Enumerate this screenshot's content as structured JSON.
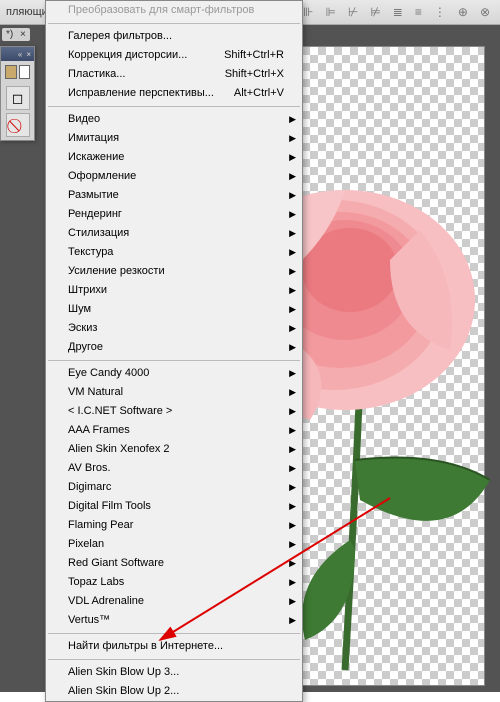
{
  "toolbar": {
    "label_fragment": "пляющие элементы",
    "file_tab": "*)"
  },
  "menu": {
    "top_item": "Преобразовать для смарт-фильтров",
    "group1": [
      {
        "label": "Галерея фильтров..."
      },
      {
        "label": "Коррекция дисторсии...",
        "shortcut": "Shift+Ctrl+R"
      },
      {
        "label": "Пластика...",
        "shortcut": "Shift+Ctrl+X"
      },
      {
        "label": "Исправление перспективы...",
        "shortcut": "Alt+Ctrl+V"
      }
    ],
    "group2": [
      {
        "label": "Видео",
        "sub": true
      },
      {
        "label": "Имитация",
        "sub": true
      },
      {
        "label": "Искажение",
        "sub": true
      },
      {
        "label": "Оформление",
        "sub": true
      },
      {
        "label": "Размытие",
        "sub": true
      },
      {
        "label": "Рендеринг",
        "sub": true
      },
      {
        "label": "Стилизация",
        "sub": true
      },
      {
        "label": "Текстура",
        "sub": true
      },
      {
        "label": "Усиление резкости",
        "sub": true
      },
      {
        "label": "Штрихи",
        "sub": true
      },
      {
        "label": "Шум",
        "sub": true
      },
      {
        "label": "Эскиз",
        "sub": true
      },
      {
        "label": "Другое",
        "sub": true
      }
    ],
    "group3": [
      {
        "label": " Eye Candy 4000",
        "sub": true
      },
      {
        "label": " VM Natural",
        "sub": true
      },
      {
        "label": "< I.C.NET Software >",
        "sub": true
      },
      {
        "label": "AAA Frames",
        "sub": true
      },
      {
        "label": "Alien Skin Xenofex 2",
        "sub": true
      },
      {
        "label": "AV Bros.",
        "sub": true
      },
      {
        "label": "Digimarc",
        "sub": true
      },
      {
        "label": "Digital Film Tools",
        "sub": true
      },
      {
        "label": "Flaming Pear",
        "sub": true
      },
      {
        "label": "Pixelan",
        "sub": true
      },
      {
        "label": "Red Giant Software",
        "sub": true
      },
      {
        "label": "Topaz Labs",
        "sub": true
      },
      {
        "label": "VDL Adrenaline",
        "sub": true
      },
      {
        "label": "Vertus™",
        "sub": true
      }
    ],
    "browse": "Найти фильтры в Интернете...",
    "group4": [
      {
        "label": "Alien Skin Blow Up 3..."
      },
      {
        "label": "Alien Skin Blow Up 2..."
      }
    ]
  }
}
